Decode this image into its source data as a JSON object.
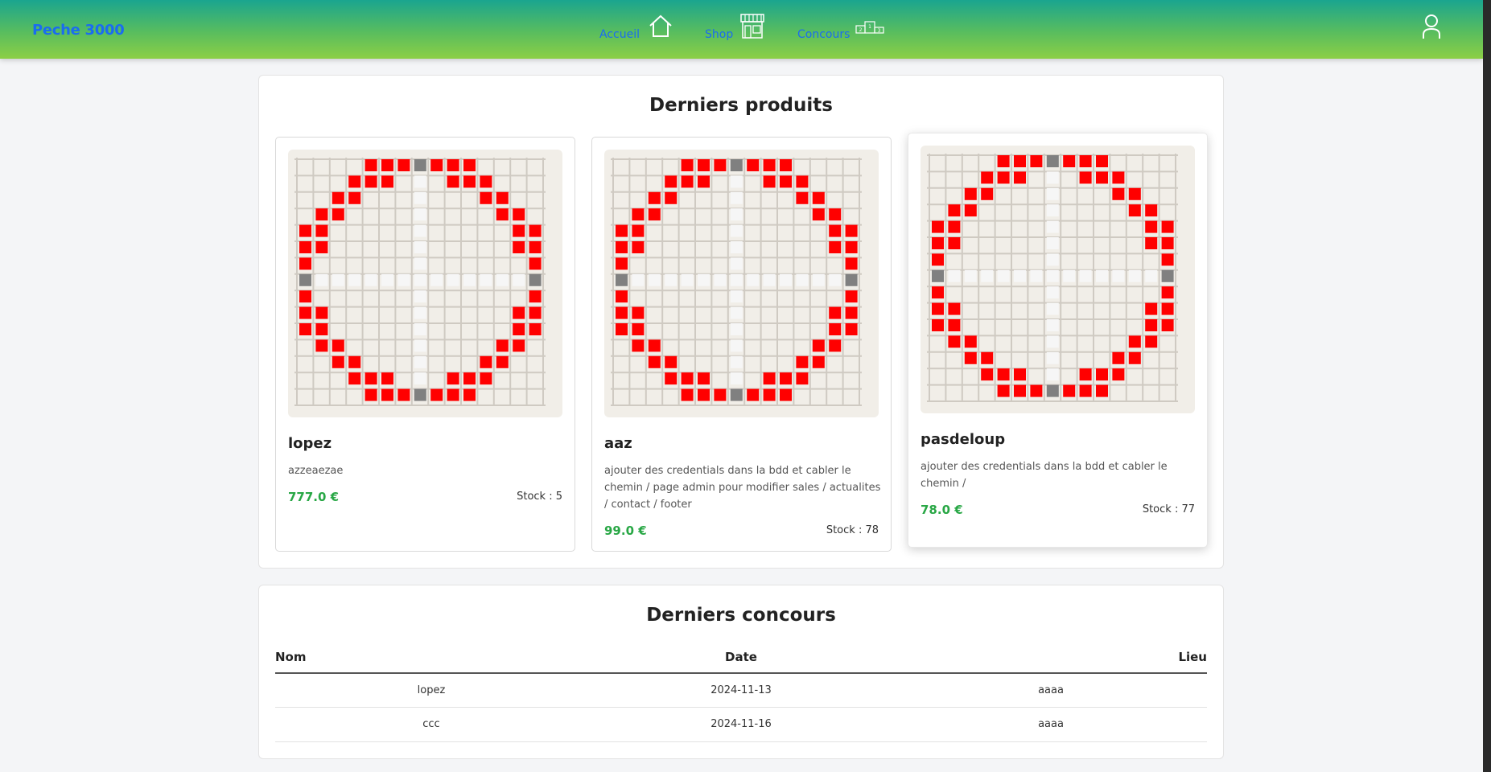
{
  "nav": {
    "brand": "Peche 3000",
    "links": [
      {
        "label": "Accueil",
        "icon": "home-icon"
      },
      {
        "label": "Shop",
        "icon": "shop-icon"
      },
      {
        "label": "Concours",
        "icon": "podium-icon"
      }
    ],
    "user_icon": "user-icon"
  },
  "products": {
    "title": "Derniers produits",
    "items": [
      {
        "name": "lopez",
        "description": "azzeaezae",
        "price": "777.0 €",
        "stock": "Stock : 5"
      },
      {
        "name": "aaz",
        "description": "ajouter des credentials dans la bdd et cabler le chemin / page admin pour modifier sales / actualites / contact / footer",
        "price": "99.0 €",
        "stock": "Stock : 78"
      },
      {
        "name": "pasdeloup",
        "description": "ajouter des credentials dans la bdd et cabler le chemin /",
        "price": "78.0 €",
        "stock": "Stock : 77"
      }
    ]
  },
  "contests": {
    "title": "Derniers concours",
    "columns": [
      "Nom",
      "Date",
      "Lieu"
    ],
    "rows": [
      [
        "lopez",
        "2024-11-13",
        "aaaa"
      ],
      [
        "ccc",
        "2024-11-16",
        "aaaa"
      ]
    ]
  },
  "colors": {
    "brand": "#1a6cf0",
    "price": "#28a745",
    "pattern_red": "#ff0000",
    "pattern_gray": "#808080"
  }
}
